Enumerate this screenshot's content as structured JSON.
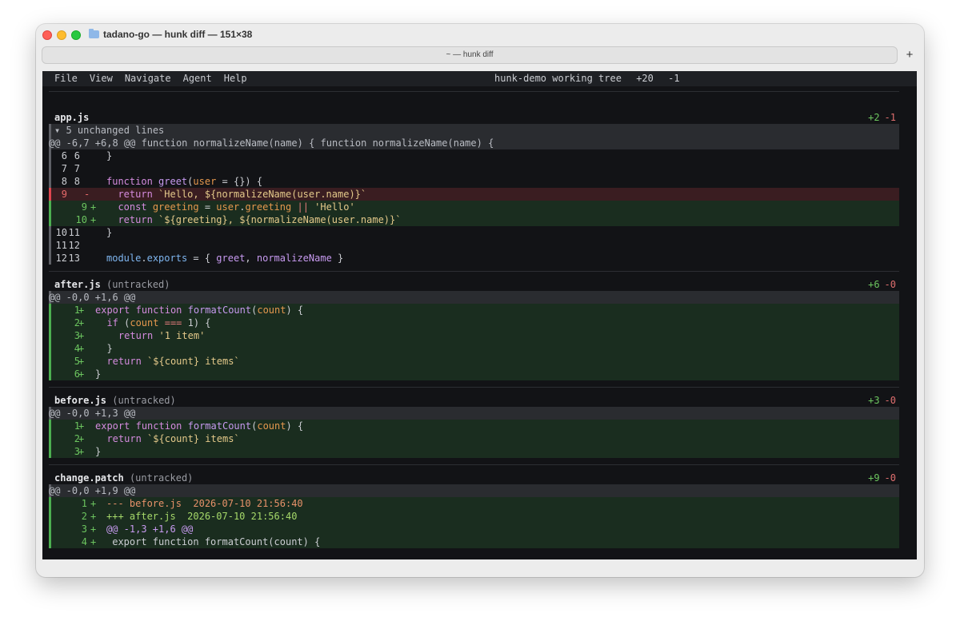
{
  "window": {
    "title": "tadano-go — hunk diff — 151×38",
    "tab_title": "~ — hunk diff",
    "new_tab": "+"
  },
  "menubar": {
    "items": [
      "File",
      "View",
      "Navigate",
      "Agent",
      "Help"
    ],
    "repo_label": "hunk-demo working tree",
    "additions": "+20",
    "deletions": "-1"
  },
  "files": [
    {
      "name": "app.js",
      "untracked": "",
      "stat_add": "+2",
      "stat_del": "-1",
      "collapsed": "▾ 5 unchanged lines",
      "hunk_header": "@@ -6,7 +6,8 @@ function normalizeName(name) { function normalizeName(name) {",
      "lines": [
        {
          "type": "ctx",
          "old": "6",
          "new": "6",
          "code": "}"
        },
        {
          "type": "ctx",
          "old": "7",
          "new": "7",
          "code": ""
        },
        {
          "type": "ctx",
          "old": "8",
          "new": "8",
          "code": "function greet(user = {}) {"
        },
        {
          "type": "del",
          "old": "9",
          "new": "",
          "code": "  return `Hello, ${normalizeName(user.name)}`"
        },
        {
          "type": "add",
          "old": "",
          "new": "9",
          "code": "  const greeting = user.greeting || 'Hello'"
        },
        {
          "type": "add",
          "old": "",
          "new": "10",
          "code": "  return `${greeting}, ${normalizeName(user.name)}`"
        },
        {
          "type": "ctx",
          "old": "10",
          "new": "11",
          "code": "}"
        },
        {
          "type": "ctx",
          "old": "11",
          "new": "12",
          "code": ""
        },
        {
          "type": "ctx",
          "old": "12",
          "new": "13",
          "code": "module.exports = { greet, normalizeName }"
        }
      ]
    },
    {
      "name": "after.js",
      "untracked": "(untracked)",
      "stat_add": "+6",
      "stat_del": "-0",
      "hunk_header": "@@ -0,0 +1,6 @@",
      "lines": [
        {
          "type": "add",
          "new": "1",
          "code": "export function formatCount(count) {"
        },
        {
          "type": "add",
          "new": "2",
          "code": "  if (count === 1) {"
        },
        {
          "type": "add",
          "new": "3",
          "code": "    return '1 item'"
        },
        {
          "type": "add",
          "new": "4",
          "code": "  }"
        },
        {
          "type": "add",
          "new": "5",
          "code": "  return `${count} items`"
        },
        {
          "type": "add",
          "new": "6",
          "code": "}"
        }
      ]
    },
    {
      "name": "before.js",
      "untracked": "(untracked)",
      "stat_add": "+3",
      "stat_del": "-0",
      "hunk_header": "@@ -0,0 +1,3 @@",
      "lines": [
        {
          "type": "add",
          "new": "1",
          "code": "export function formatCount(count) {"
        },
        {
          "type": "add",
          "new": "2",
          "code": "  return `${count} items`"
        },
        {
          "type": "add",
          "new": "3",
          "code": "}"
        }
      ]
    },
    {
      "name": "change.patch",
      "untracked": "(untracked)",
      "stat_add": "+9",
      "stat_del": "-0",
      "hunk_header": "@@ -0,0 +1,9 @@",
      "lines": [
        {
          "type": "add",
          "new": "1",
          "code": "--- before.js  2026-07-10 21:56:40"
        },
        {
          "type": "add",
          "new": "2",
          "code": "+++ after.js  2026-07-10 21:56:40"
        },
        {
          "type": "add",
          "new": "3",
          "code": "@@ -1,3 +1,6 @@"
        },
        {
          "type": "add",
          "new": "4",
          "code": " export function formatCount(count) {"
        }
      ]
    }
  ]
}
